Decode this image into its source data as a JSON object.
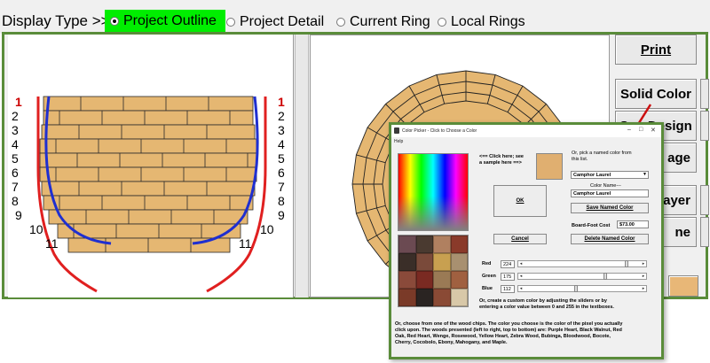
{
  "top_bar": {
    "display_type_label": "Display Type >>",
    "options": [
      "Project Outline",
      "Project Detail",
      "Current Ring",
      "Local Rings"
    ],
    "selected_index": 0,
    "selected_color": "#00ee00"
  },
  "ring_labels": {
    "left": [
      "1",
      "2",
      "3",
      "4",
      "5",
      "6",
      "7",
      "8",
      "9",
      "10",
      "11"
    ],
    "right": [
      "1",
      "2",
      "3",
      "4",
      "5",
      "6",
      "7",
      "8",
      "9",
      "10",
      "11"
    ],
    "highlight_color": "#cc0000"
  },
  "colors": {
    "wood": "#e5b772",
    "profile_outer": "#e02020",
    "profile_inner": "#1f2fd0",
    "frame": "#5a8c3a",
    "arrow": "#cc1111"
  },
  "side_buttons": {
    "print": "Print",
    "solid_color": "Solid Color",
    "seg_design": "Seg Design",
    "image_partial": "age",
    "layer_partial": "ayer",
    "line_partial": "ne"
  },
  "color_picker": {
    "title": "Color Picker - Click to Choose a Color",
    "menu_help": "Help",
    "click_here_text_1": "<== Click here; see",
    "click_here_text_2": "a sample here ==>",
    "or_pick_text_1": "Or, pick a named color from",
    "or_pick_text_2": "this list.",
    "selected_named_color": "Camphor Laurel",
    "color_name_label": "Color Name---",
    "color_name_value": "Camphor Laurel",
    "ok_label": "OK",
    "cancel_label": "Cancel",
    "save_named_color_label": "Save Named Color",
    "board_foot_cost_label": "Board-Foot Cost",
    "board_foot_cost_value": "$73.00",
    "delete_named_color_label": "Delete Named Color",
    "sample_color": "#e0af70",
    "sliders": [
      {
        "label": "Red",
        "value": "224",
        "fraction": 0.88
      },
      {
        "label": "Green",
        "value": "175",
        "fraction": 0.69
      },
      {
        "label": "Blue",
        "value": "112",
        "fraction": 0.44
      }
    ],
    "custom_text_1": "Or, create a custom color by adjusting the sliders or by",
    "custom_text_2": "entering a color value between 0 and 255 in the textboxes.",
    "chips_text_1": "Or, choose from one of the wood chips. The color you choose is the color of the pixel you actually",
    "chips_text_2": "click upon. The woods presented (left to right, top to bottom) are: Purple Heart, Black Walnut, Red",
    "chips_text_3": "Oak, Red Heart, Wenge, Rosewood, Yellow Heart, Zebra Wood, Bubinga, Bloodwood, Bocote,",
    "chips_text_4": "Cherry, Cocobolo, Ebony, Mahogany, and Maple.",
    "wood_chip_colors": [
      "#6b4a52",
      "#4a3a30",
      "#b08060",
      "#8a3a2a",
      "#3a2e28",
      "#7a4a3a",
      "#c8a050",
      "#a89070",
      "#8a4a3a",
      "#7a2a22",
      "#9a7a55",
      "#a06040",
      "#7a3a28",
      "#2a2422",
      "#8a4a35",
      "#d8c8a8"
    ]
  }
}
